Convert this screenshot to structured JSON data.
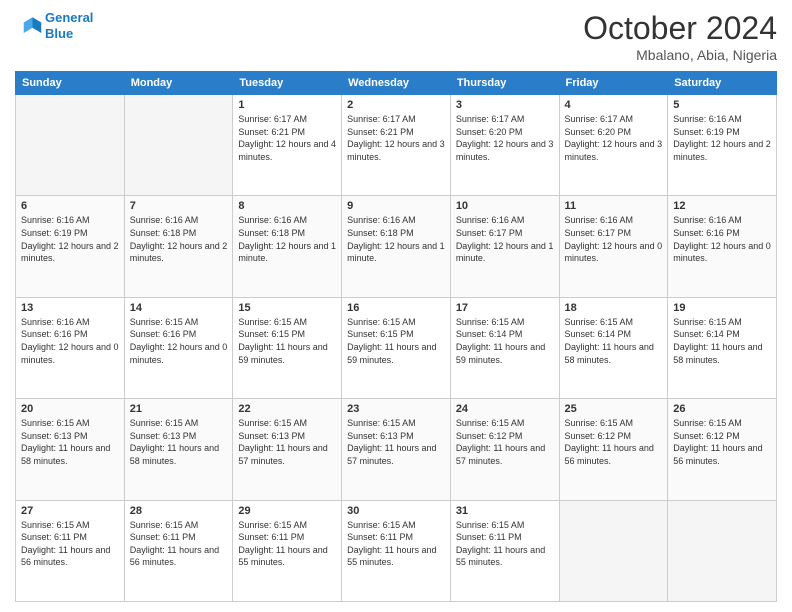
{
  "header": {
    "logo_line1": "General",
    "logo_line2": "Blue",
    "month": "October 2024",
    "location": "Mbalano, Abia, Nigeria"
  },
  "days_of_week": [
    "Sunday",
    "Monday",
    "Tuesday",
    "Wednesday",
    "Thursday",
    "Friday",
    "Saturday"
  ],
  "weeks": [
    [
      {
        "day": "",
        "info": ""
      },
      {
        "day": "",
        "info": ""
      },
      {
        "day": "1",
        "info": "Sunrise: 6:17 AM\nSunset: 6:21 PM\nDaylight: 12 hours and 4 minutes."
      },
      {
        "day": "2",
        "info": "Sunrise: 6:17 AM\nSunset: 6:21 PM\nDaylight: 12 hours and 3 minutes."
      },
      {
        "day": "3",
        "info": "Sunrise: 6:17 AM\nSunset: 6:20 PM\nDaylight: 12 hours and 3 minutes."
      },
      {
        "day": "4",
        "info": "Sunrise: 6:17 AM\nSunset: 6:20 PM\nDaylight: 12 hours and 3 minutes."
      },
      {
        "day": "5",
        "info": "Sunrise: 6:16 AM\nSunset: 6:19 PM\nDaylight: 12 hours and 2 minutes."
      }
    ],
    [
      {
        "day": "6",
        "info": "Sunrise: 6:16 AM\nSunset: 6:19 PM\nDaylight: 12 hours and 2 minutes."
      },
      {
        "day": "7",
        "info": "Sunrise: 6:16 AM\nSunset: 6:18 PM\nDaylight: 12 hours and 2 minutes."
      },
      {
        "day": "8",
        "info": "Sunrise: 6:16 AM\nSunset: 6:18 PM\nDaylight: 12 hours and 1 minute."
      },
      {
        "day": "9",
        "info": "Sunrise: 6:16 AM\nSunset: 6:18 PM\nDaylight: 12 hours and 1 minute."
      },
      {
        "day": "10",
        "info": "Sunrise: 6:16 AM\nSunset: 6:17 PM\nDaylight: 12 hours and 1 minute."
      },
      {
        "day": "11",
        "info": "Sunrise: 6:16 AM\nSunset: 6:17 PM\nDaylight: 12 hours and 0 minutes."
      },
      {
        "day": "12",
        "info": "Sunrise: 6:16 AM\nSunset: 6:16 PM\nDaylight: 12 hours and 0 minutes."
      }
    ],
    [
      {
        "day": "13",
        "info": "Sunrise: 6:16 AM\nSunset: 6:16 PM\nDaylight: 12 hours and 0 minutes."
      },
      {
        "day": "14",
        "info": "Sunrise: 6:15 AM\nSunset: 6:16 PM\nDaylight: 12 hours and 0 minutes."
      },
      {
        "day": "15",
        "info": "Sunrise: 6:15 AM\nSunset: 6:15 PM\nDaylight: 11 hours and 59 minutes."
      },
      {
        "day": "16",
        "info": "Sunrise: 6:15 AM\nSunset: 6:15 PM\nDaylight: 11 hours and 59 minutes."
      },
      {
        "day": "17",
        "info": "Sunrise: 6:15 AM\nSunset: 6:14 PM\nDaylight: 11 hours and 59 minutes."
      },
      {
        "day": "18",
        "info": "Sunrise: 6:15 AM\nSunset: 6:14 PM\nDaylight: 11 hours and 58 minutes."
      },
      {
        "day": "19",
        "info": "Sunrise: 6:15 AM\nSunset: 6:14 PM\nDaylight: 11 hours and 58 minutes."
      }
    ],
    [
      {
        "day": "20",
        "info": "Sunrise: 6:15 AM\nSunset: 6:13 PM\nDaylight: 11 hours and 58 minutes."
      },
      {
        "day": "21",
        "info": "Sunrise: 6:15 AM\nSunset: 6:13 PM\nDaylight: 11 hours and 58 minutes."
      },
      {
        "day": "22",
        "info": "Sunrise: 6:15 AM\nSunset: 6:13 PM\nDaylight: 11 hours and 57 minutes."
      },
      {
        "day": "23",
        "info": "Sunrise: 6:15 AM\nSunset: 6:13 PM\nDaylight: 11 hours and 57 minutes."
      },
      {
        "day": "24",
        "info": "Sunrise: 6:15 AM\nSunset: 6:12 PM\nDaylight: 11 hours and 57 minutes."
      },
      {
        "day": "25",
        "info": "Sunrise: 6:15 AM\nSunset: 6:12 PM\nDaylight: 11 hours and 56 minutes."
      },
      {
        "day": "26",
        "info": "Sunrise: 6:15 AM\nSunset: 6:12 PM\nDaylight: 11 hours and 56 minutes."
      }
    ],
    [
      {
        "day": "27",
        "info": "Sunrise: 6:15 AM\nSunset: 6:11 PM\nDaylight: 11 hours and 56 minutes."
      },
      {
        "day": "28",
        "info": "Sunrise: 6:15 AM\nSunset: 6:11 PM\nDaylight: 11 hours and 56 minutes."
      },
      {
        "day": "29",
        "info": "Sunrise: 6:15 AM\nSunset: 6:11 PM\nDaylight: 11 hours and 55 minutes."
      },
      {
        "day": "30",
        "info": "Sunrise: 6:15 AM\nSunset: 6:11 PM\nDaylight: 11 hours and 55 minutes."
      },
      {
        "day": "31",
        "info": "Sunrise: 6:15 AM\nSunset: 6:11 PM\nDaylight: 11 hours and 55 minutes."
      },
      {
        "day": "",
        "info": ""
      },
      {
        "day": "",
        "info": ""
      }
    ]
  ]
}
